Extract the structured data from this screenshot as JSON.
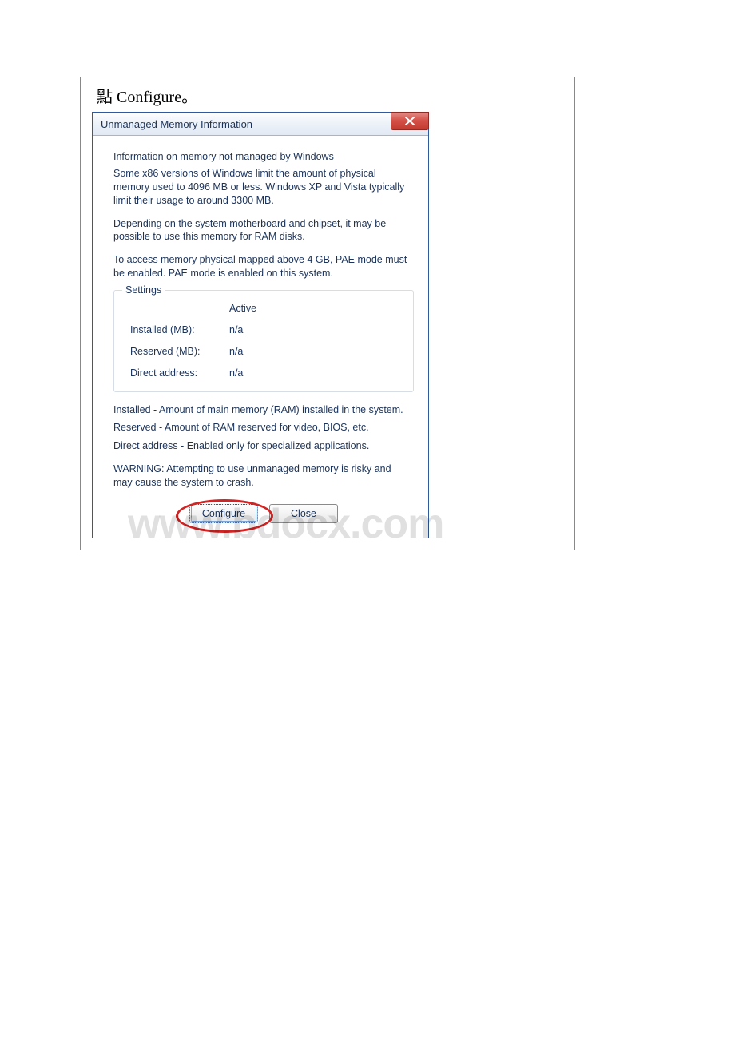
{
  "page": {
    "instruction": "點 Configure。",
    "watermark": "www.bdocx.com"
  },
  "dialog": {
    "title": "Unmanaged Memory Information",
    "close_icon": "close-x",
    "body": {
      "heading": "Information on memory not managed by Windows",
      "p1": "Some x86 versions of Windows limit the amount of physical memory used to 4096 MB or less. Windows XP and Vista typically limit their usage to around 3300 MB.",
      "p2": "Depending on the system motherboard and chipset, it may be possible to use this memory for RAM disks.",
      "p3": "To access memory physical mapped above 4 GB, PAE mode must be enabled. PAE mode is enabled on this system.",
      "settings": {
        "legend": "Settings",
        "column_header": "Active",
        "rows": [
          {
            "label": "Installed (MB):",
            "value": "n/a"
          },
          {
            "label": "Reserved (MB):",
            "value": "n/a"
          },
          {
            "label": "Direct address:",
            "value": "n/a"
          }
        ]
      },
      "def1": "Installed - Amount of main memory (RAM) installed in the system.",
      "def2": "Reserved - Amount of RAM reserved for video, BIOS, etc.",
      "def3": "Direct address - Enabled only for specialized applications.",
      "warning": "WARNING: Attempting to use unmanaged memory is risky and may cause the system to crash."
    },
    "buttons": {
      "configure": "Configure",
      "close": "Close"
    }
  }
}
